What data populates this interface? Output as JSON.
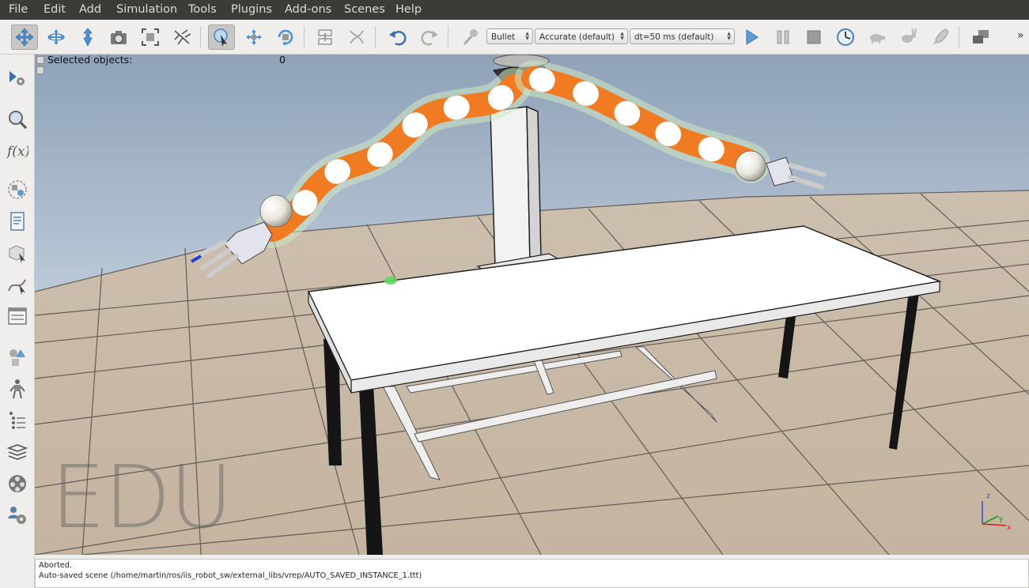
{
  "menu": [
    "File",
    "Edit",
    "Add",
    "Simulation",
    "Tools",
    "Plugins",
    "Add-ons",
    "Scenes",
    "Help"
  ],
  "toolbar": {
    "engine": "Bullet",
    "accuracy": "Accurate (default)",
    "dt": "dt=50 ms (default)",
    "more": "»"
  },
  "icons": {
    "toolbar": [
      "camera-pan-icon",
      "camera-rotate-icon",
      "camera-shift-icon",
      "camera-angle-icon",
      "fit-to-view-icon",
      "assemble-icon",
      "click-select-icon",
      "object-shift-icon",
      "object-rotate-icon",
      "assembly-icon",
      "transfer-dna-icon",
      "undo-icon",
      "redo-icon",
      "simulation-engine-icon",
      "start-simulation-icon",
      "pause-simulation-icon",
      "stop-simulation-icon",
      "realtime-icon",
      "slow-down-icon",
      "speed-up-icon",
      "threaded-rendering-icon",
      "toggle-pages-icon"
    ],
    "sidebar": [
      "simulation-settings-icon",
      "selection-icon",
      "calculation-modules-icon",
      "collections-icon",
      "scripts-icon",
      "shape-edit-icon",
      "path-edit-icon",
      "user-settings-icon",
      "model-browser-icon",
      "scene-hierarchy-icon",
      "layers-icon",
      "video-recorder-icon",
      "user-settings-2-icon"
    ]
  },
  "hierarchy": {
    "selected_label": "Selected objects:",
    "selected_count": "0"
  },
  "viewport": {
    "watermark": "EDU",
    "axes": {
      "z": "z",
      "y": "y",
      "x": "x"
    },
    "colors": {
      "sky_top": "#8fa2b8",
      "sky_bottom": "#e9eef4",
      "robot": "#f07b22",
      "table": "#ffffff"
    }
  },
  "status": {
    "line1": "Aborted.",
    "line2": "Auto-saved scene (/home/martin/ros/iis_robot_sw/external_libs/vrep/AUTO_SAVED_INSTANCE_1.ttt)"
  }
}
